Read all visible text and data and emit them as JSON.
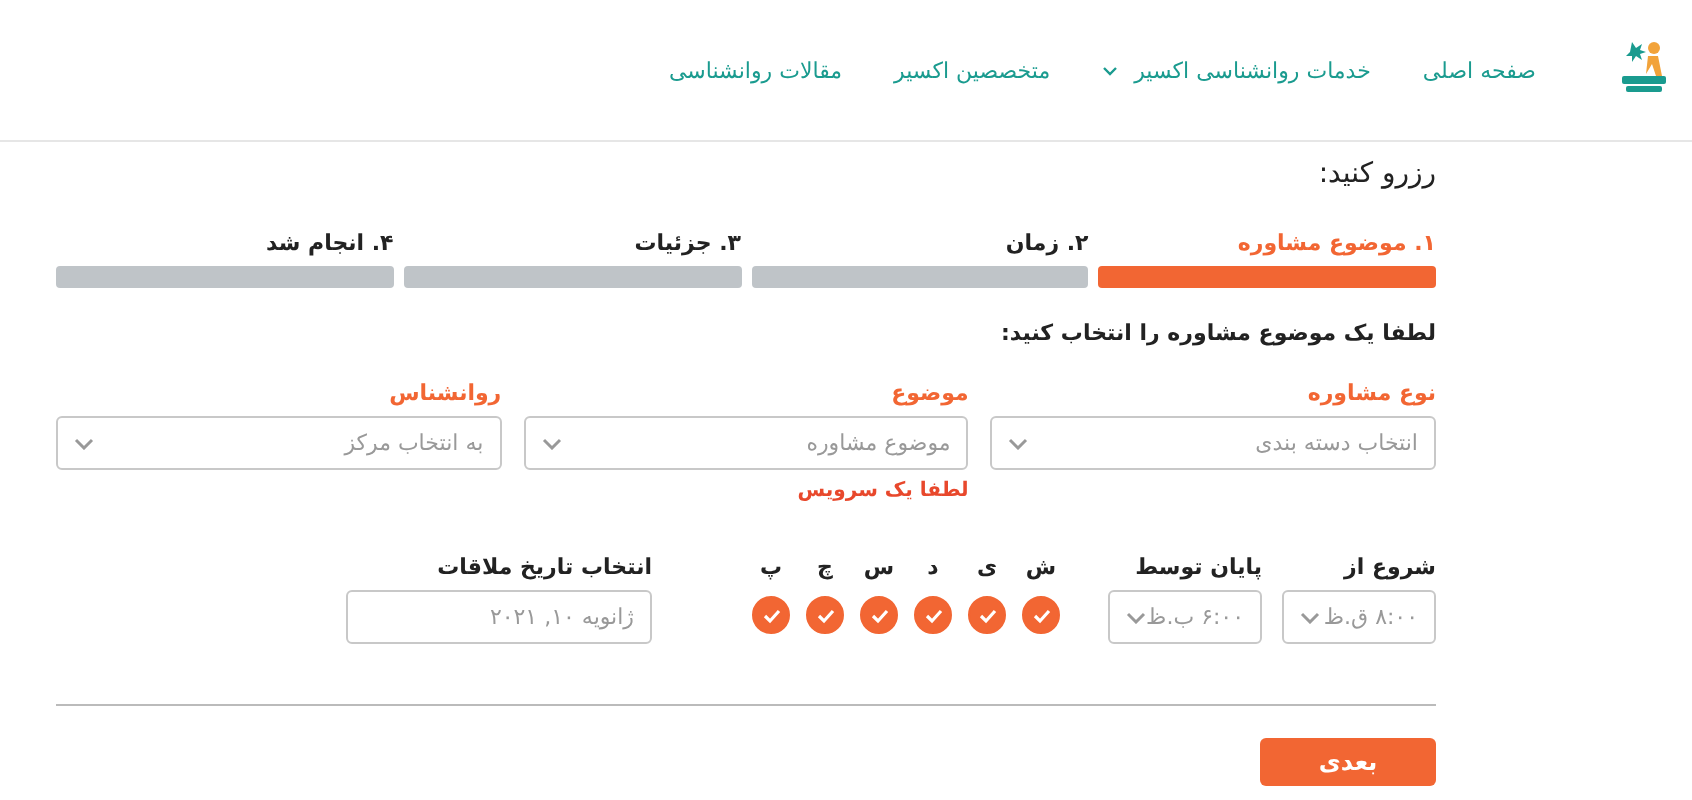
{
  "nav": {
    "items": [
      {
        "label": "صفحه اصلی",
        "has_menu": false
      },
      {
        "label": "خدمات روانشناسی اکسیر",
        "has_menu": true
      },
      {
        "label": "متخصصین اکسیر",
        "has_menu": false
      },
      {
        "label": "مقالات روانشناسی",
        "has_menu": false
      }
    ]
  },
  "title": "رزرو کنید:",
  "steps": [
    {
      "label": "۱. موضوع مشاوره",
      "selected": true
    },
    {
      "label": "۲. زمان",
      "selected": false
    },
    {
      "label": "۳. جزئیات",
      "selected": false
    },
    {
      "label": "۴. انجام شد",
      "selected": false
    }
  ],
  "instruction": "لطفا یک موضوع مشاوره را انتخاب کنید:",
  "fields": [
    {
      "label": "نوع مشاوره",
      "placeholder": "انتخاب دسته بندی"
    },
    {
      "label": "موضوع",
      "placeholder": "موضوع مشاوره",
      "error": "لطفا یک سرویس"
    },
    {
      "label": "روانشناس",
      "placeholder": "به انتخاب مرکز"
    }
  ],
  "start": {
    "label": "شروع از",
    "value": "۸:۰۰ ق.ظ"
  },
  "end": {
    "label": "پایان توسط",
    "value": "۶:۰۰ ب.ظ"
  },
  "days": [
    {
      "label": "ش",
      "checked": true
    },
    {
      "label": "ی",
      "checked": true
    },
    {
      "label": "د",
      "checked": true
    },
    {
      "label": "س",
      "checked": true
    },
    {
      "label": "چ",
      "checked": true
    },
    {
      "label": "پ",
      "checked": true
    }
  ],
  "date": {
    "label": "انتخاب تاریخ ملاقات",
    "placeholder": "ژانویه ۱۰, ۲۰۲۱"
  },
  "next_button": "بعدی"
}
